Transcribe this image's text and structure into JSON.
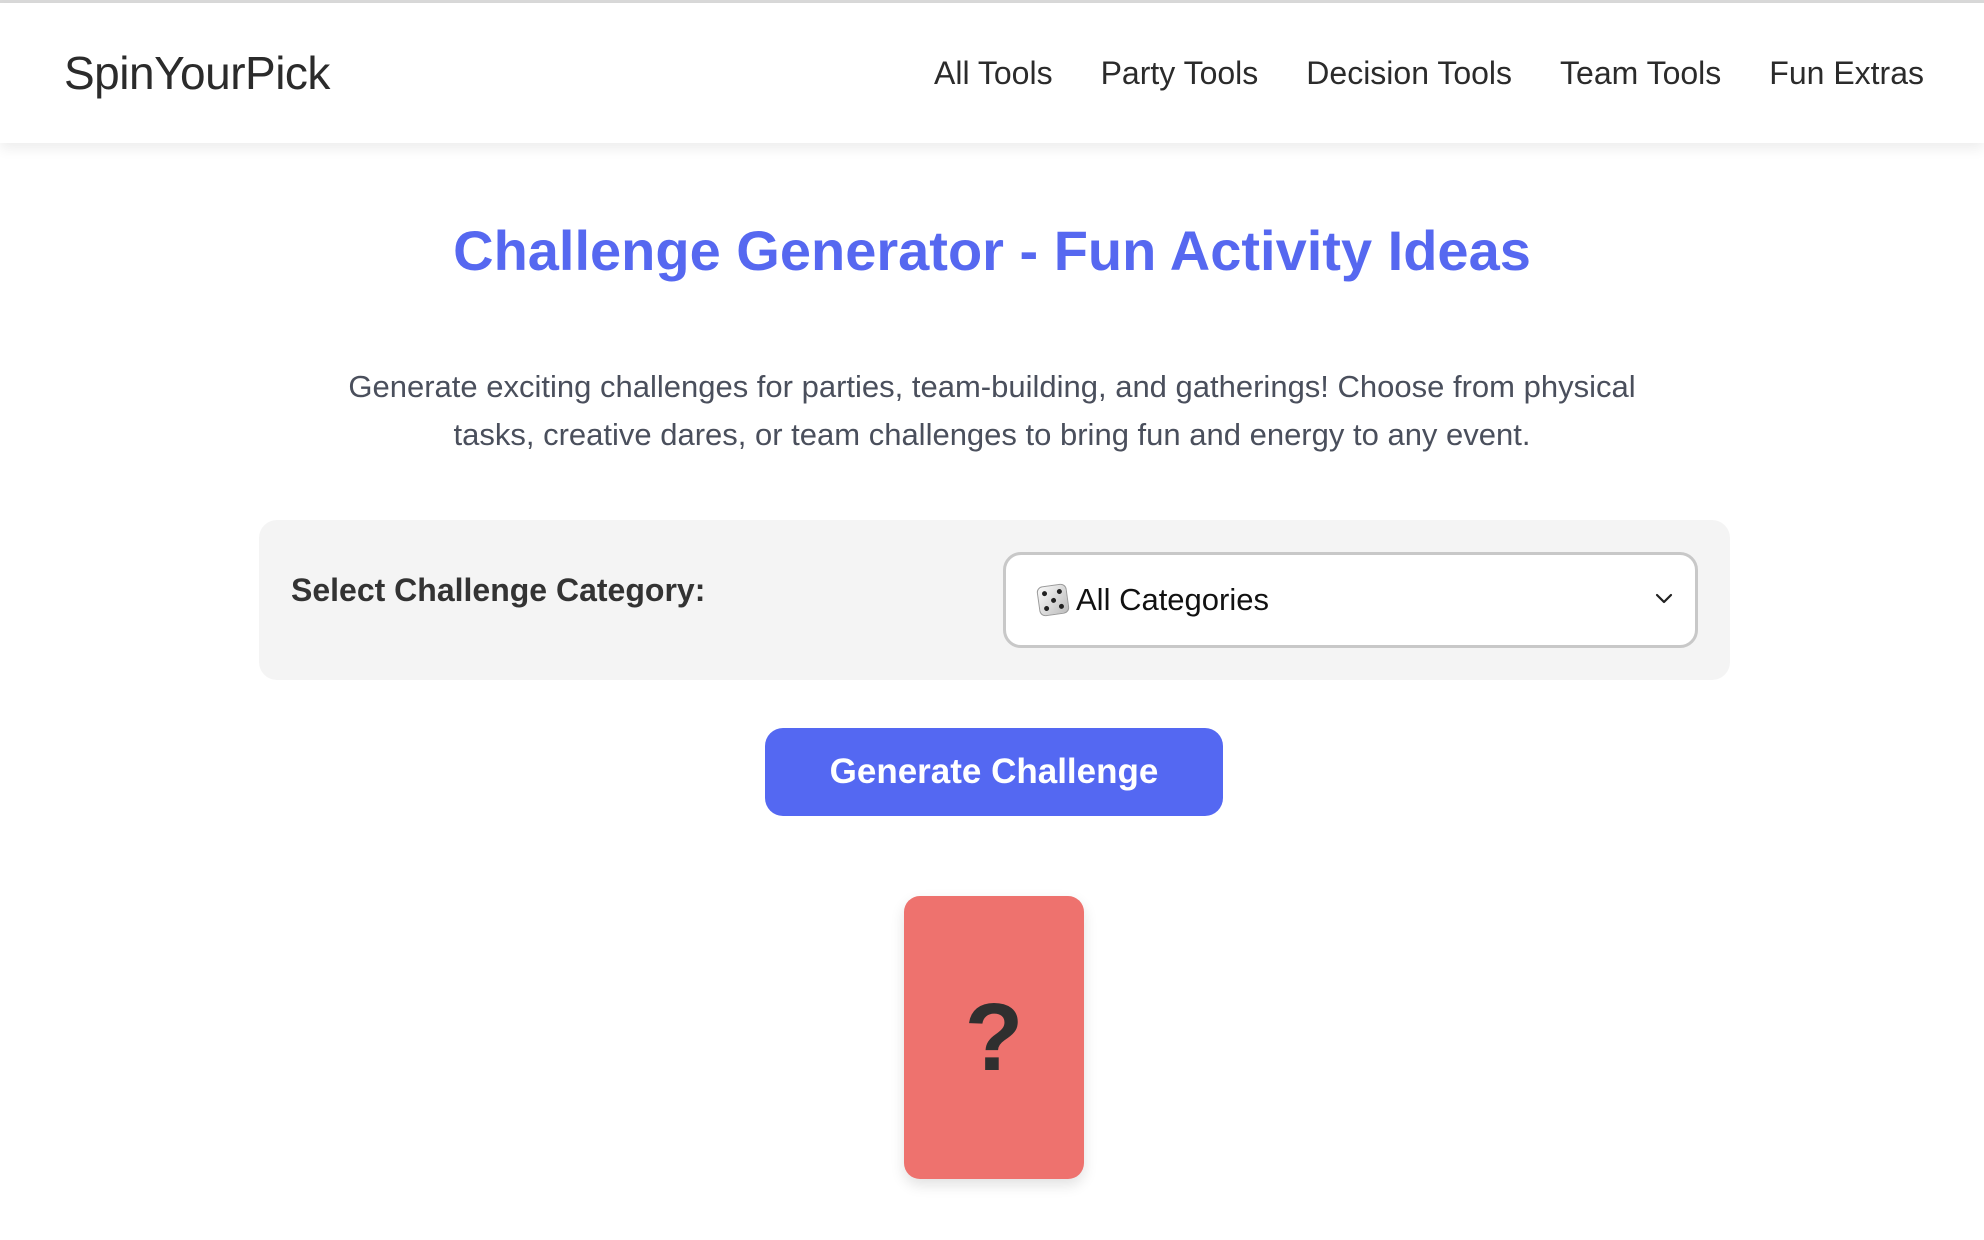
{
  "header": {
    "logo": "SpinYourPick",
    "nav": [
      "All Tools",
      "Party Tools",
      "Decision Tools",
      "Team Tools",
      "Fun Extras"
    ]
  },
  "main": {
    "title": "Challenge Generator - Fun Activity Ideas",
    "intro": "Generate exciting challenges for parties, team-building, and gatherings! Choose from physical tasks, creative dares, or team challenges to bring fun and energy to any event.",
    "category_label": "Select Challenge Category:",
    "category_select": {
      "icon": "dice-icon",
      "value": "All Categories"
    },
    "generate_button": "Generate Challenge",
    "card": {
      "symbol": "?",
      "color": "#ee726e"
    }
  },
  "colors": {
    "accent": "#5668f0",
    "button": "#5468f2",
    "card": "#ee726e",
    "panel": "#f4f4f4"
  }
}
